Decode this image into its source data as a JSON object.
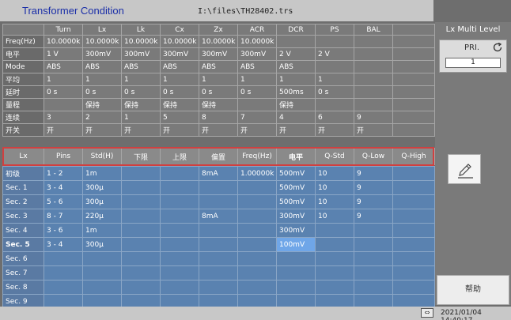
{
  "app": {
    "title": "Transformer Condition",
    "file_path": "I:\\files\\TH28402.trs"
  },
  "top_table": {
    "columns": [
      "",
      "Turn",
      "Lx",
      "Lk",
      "Cx",
      "Zx",
      "ACR",
      "DCR",
      "PS",
      "BAL",
      ""
    ],
    "rows": [
      [
        "Freq(Hz)",
        "10.0000k",
        "10.0000k",
        "10.0000k",
        "10.0000k",
        "10.0000k",
        "10.0000k",
        "",
        "",
        "",
        ""
      ],
      [
        "电平",
        "1 V",
        "300mV",
        "300mV",
        "300mV",
        "300mV",
        "300mV",
        "2 V",
        "2 V",
        "",
        ""
      ],
      [
        "Mode",
        "ABS",
        "ABS",
        "ABS",
        "ABS",
        "ABS",
        "ABS",
        "ABS",
        "",
        "",
        ""
      ],
      [
        "平均",
        "1",
        "1",
        "1",
        "1",
        "1",
        "1",
        "1",
        "1",
        "",
        ""
      ],
      [
        "延时",
        "0 s",
        "0 s",
        "0 s",
        "0 s",
        "0 s",
        "0 s",
        "500ms",
        "0 s",
        "",
        ""
      ],
      [
        "量程",
        "",
        "保持",
        "保持",
        "保持",
        "保持",
        "",
        "保持",
        "",
        "",
        ""
      ],
      [
        "连续",
        "3",
        "2",
        "1",
        "5",
        "8",
        "7",
        "4",
        "6",
        "9",
        ""
      ],
      [
        "开关",
        "开",
        "开",
        "开",
        "开",
        "开",
        "开",
        "开",
        "开",
        "开",
        ""
      ]
    ]
  },
  "lx_header": [
    "Lx",
    "Pins",
    "Std(H)",
    "下限",
    "上限",
    "偏置",
    "Freq(Hz)",
    "电平",
    "Q-Std",
    "Q-Low",
    "Q-High"
  ],
  "secondary_table": {
    "rows": [
      [
        "初级",
        "1 - 2",
        "1m",
        "",
        "",
        "8mA",
        "1.00000k",
        "500mV",
        "10",
        "9",
        ""
      ],
      [
        "Sec. 1",
        "3 - 4",
        "300μ",
        "",
        "",
        "",
        "",
        "500mV",
        "10",
        "9",
        ""
      ],
      [
        "Sec. 2",
        "5 - 6",
        "300μ",
        "",
        "",
        "",
        "",
        "500mV",
        "10",
        "9",
        ""
      ],
      [
        "Sec. 3",
        "8 - 7",
        "220μ",
        "",
        "",
        "8mA",
        "",
        "300mV",
        "10",
        "9",
        ""
      ],
      [
        "Sec. 4",
        "3 - 6",
        "1m",
        "",
        "",
        "",
        "",
        "300mV",
        "",
        "",
        ""
      ],
      [
        "Sec. 5",
        "3 - 4",
        "300μ",
        "",
        "",
        "",
        "",
        "100mV",
        "",
        "",
        ""
      ],
      [
        "Sec. 6",
        "",
        "",
        "",
        "",
        "",
        "",
        "",
        "",
        "",
        ""
      ],
      [
        "Sec. 7",
        "",
        "",
        "",
        "",
        "",
        "",
        "",
        "",
        "",
        ""
      ],
      [
        "Sec. 8",
        "",
        "",
        "",
        "",
        "",
        "",
        "",
        "",
        "",
        ""
      ],
      [
        "Sec. 9",
        "",
        "",
        "",
        "",
        "",
        "",
        "",
        "",
        "",
        ""
      ]
    ]
  },
  "right_panel": {
    "title": "Lx Multi Level",
    "pri_label": "PRI.",
    "pri_value": "1",
    "help_label": "帮助"
  },
  "status": {
    "datetime": "2021/01/04 14:40:17"
  },
  "icons": {
    "refresh": "refresh-icon",
    "edit": "pencil-icon",
    "usb": "usb-icon"
  }
}
